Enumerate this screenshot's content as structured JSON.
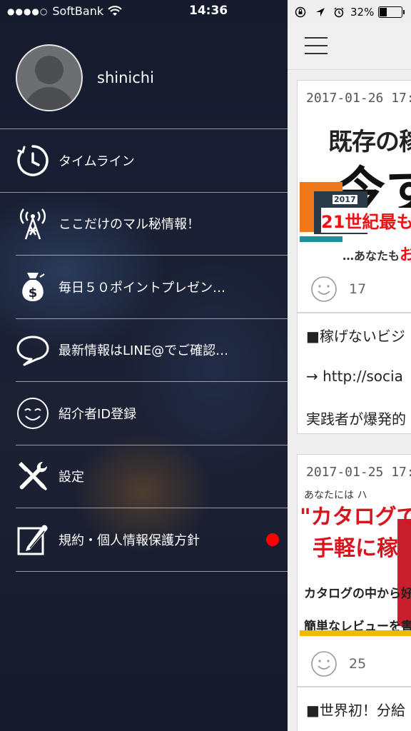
{
  "status_bar": {
    "carrier": "SoftBank",
    "time": "14:36",
    "battery": "32%"
  },
  "profile": {
    "username": "shinichi"
  },
  "menu": {
    "items": [
      {
        "label": "タイムライン",
        "icon": "clock-icon"
      },
      {
        "label": "ここだけのマル秘情報！",
        "icon": "antenna-icon"
      },
      {
        "label": "毎日５０ポイントプレゼン…",
        "icon": "money-bag-icon"
      },
      {
        "label": "最新情報はLINE@でご確認…",
        "icon": "speech-bubble-icon"
      },
      {
        "label": "紹介者ID登録",
        "icon": "smiley-icon"
      },
      {
        "label": "設定",
        "icon": "tools-icon"
      },
      {
        "label": "規約・個人情報保護方針",
        "icon": "edit-document-icon"
      }
    ]
  },
  "colors": {
    "notification_dot": "#ff0000"
  },
  "feed": {
    "posts": [
      {
        "date": "2017-01-26 17:",
        "image_text": {
          "line1": "既存の稼",
          "line2": "今す",
          "year": "2017",
          "line3": "21世紀最も",
          "line4_prefix": "…あなたも",
          "line4_highlight": "お"
        },
        "likes": "17",
        "body": [
          "■稼げないビジ",
          "→ http://socia",
          "実践者が爆発的"
        ]
      },
      {
        "date": "2017-01-25 17:",
        "image_text": {
          "line0": "あなたには ハ",
          "line1": "\"カタログで",
          "line2": "手軽に稼",
          "line3": "カタログの中から好",
          "line4": "簡単なレビューを書"
        },
        "likes": "25",
        "body": [
          "■世界初！分給"
        ]
      }
    ]
  }
}
